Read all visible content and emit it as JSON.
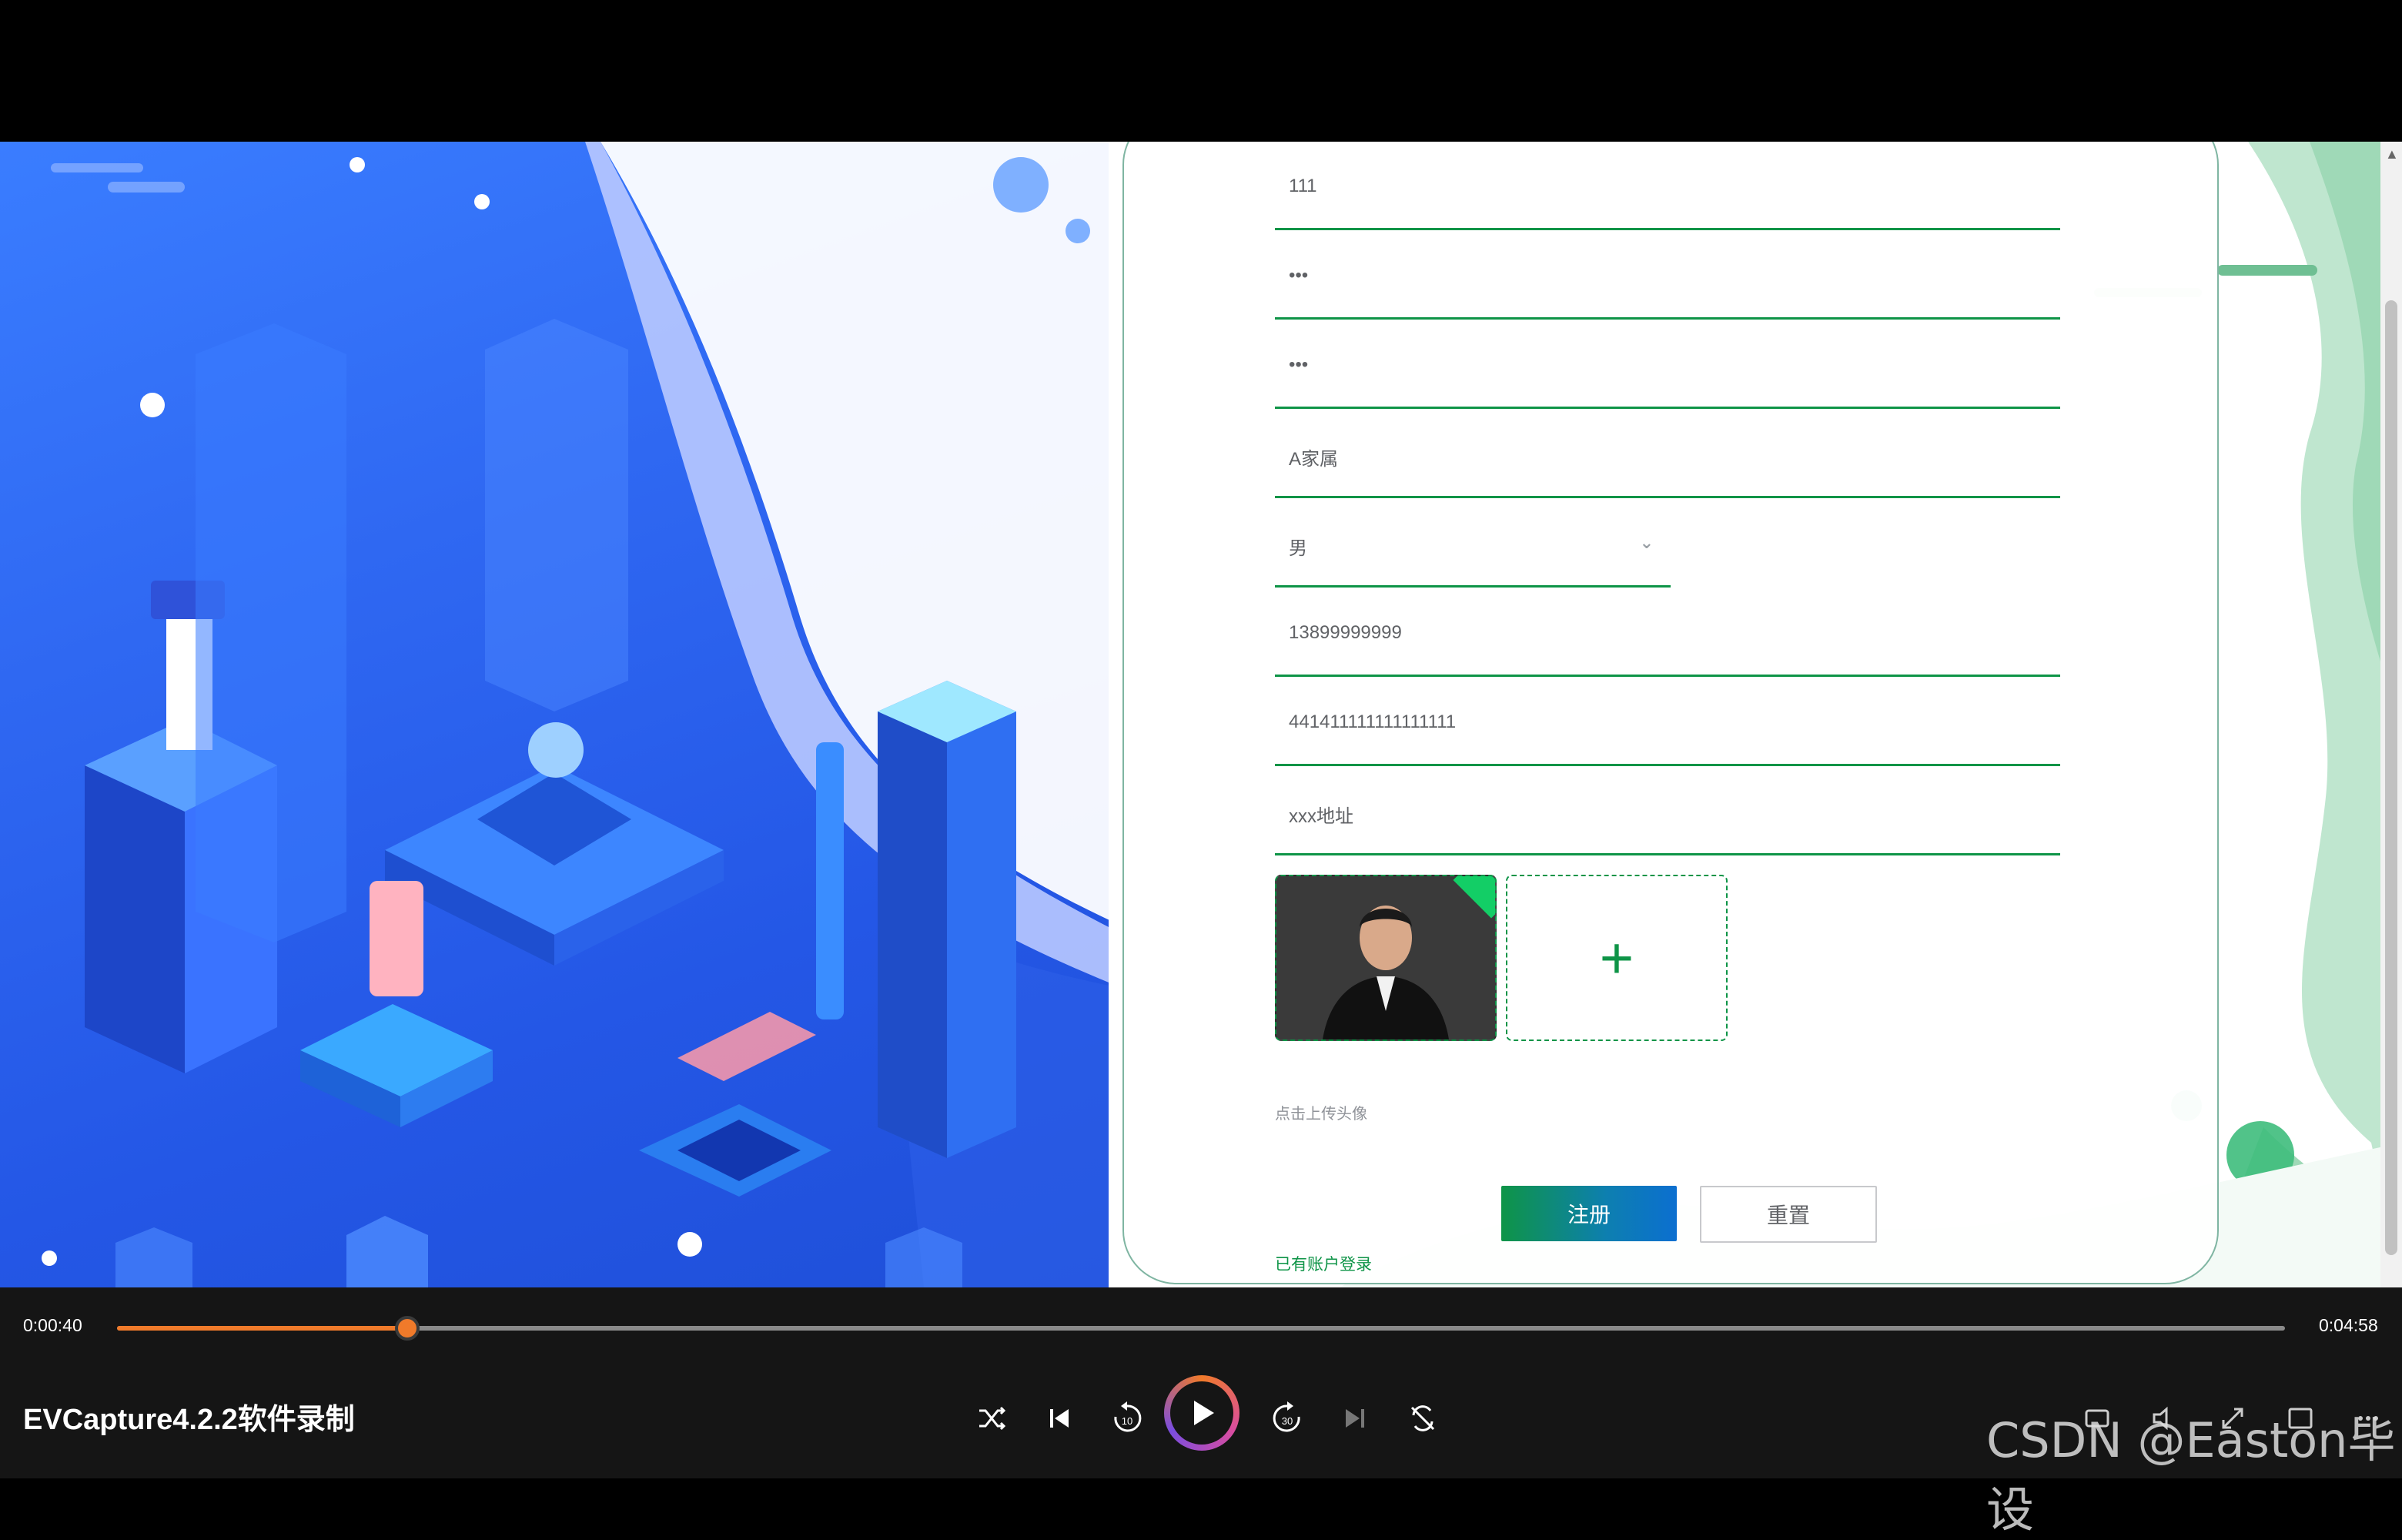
{
  "form": {
    "username": "111",
    "password": "•••",
    "confirm_password": "•••",
    "name": "A家属",
    "gender": "男",
    "phone": "13899999999",
    "id_card": "441411111111111111",
    "address": "xxx地址",
    "avatar_hint": "点击上传头像",
    "register_label": "注册",
    "reset_label": "重置",
    "login_link": "已有账户登录"
  },
  "player": {
    "current_time": "0:00:40",
    "total_time": "0:04:58",
    "progress": 0.134,
    "title": "EVCapture4.2.2软件录制",
    "watermark": "CSDN @Easton毕设"
  },
  "icons": [
    "shuffle-icon",
    "prev-icon",
    "rewind-10-icon",
    "play-icon",
    "forward-30-icon",
    "next-icon",
    "repeat-icon",
    "subtitles-icon",
    "volume-icon",
    "fullscreen-icon",
    "miniplayer-icon",
    "more-icon"
  ]
}
